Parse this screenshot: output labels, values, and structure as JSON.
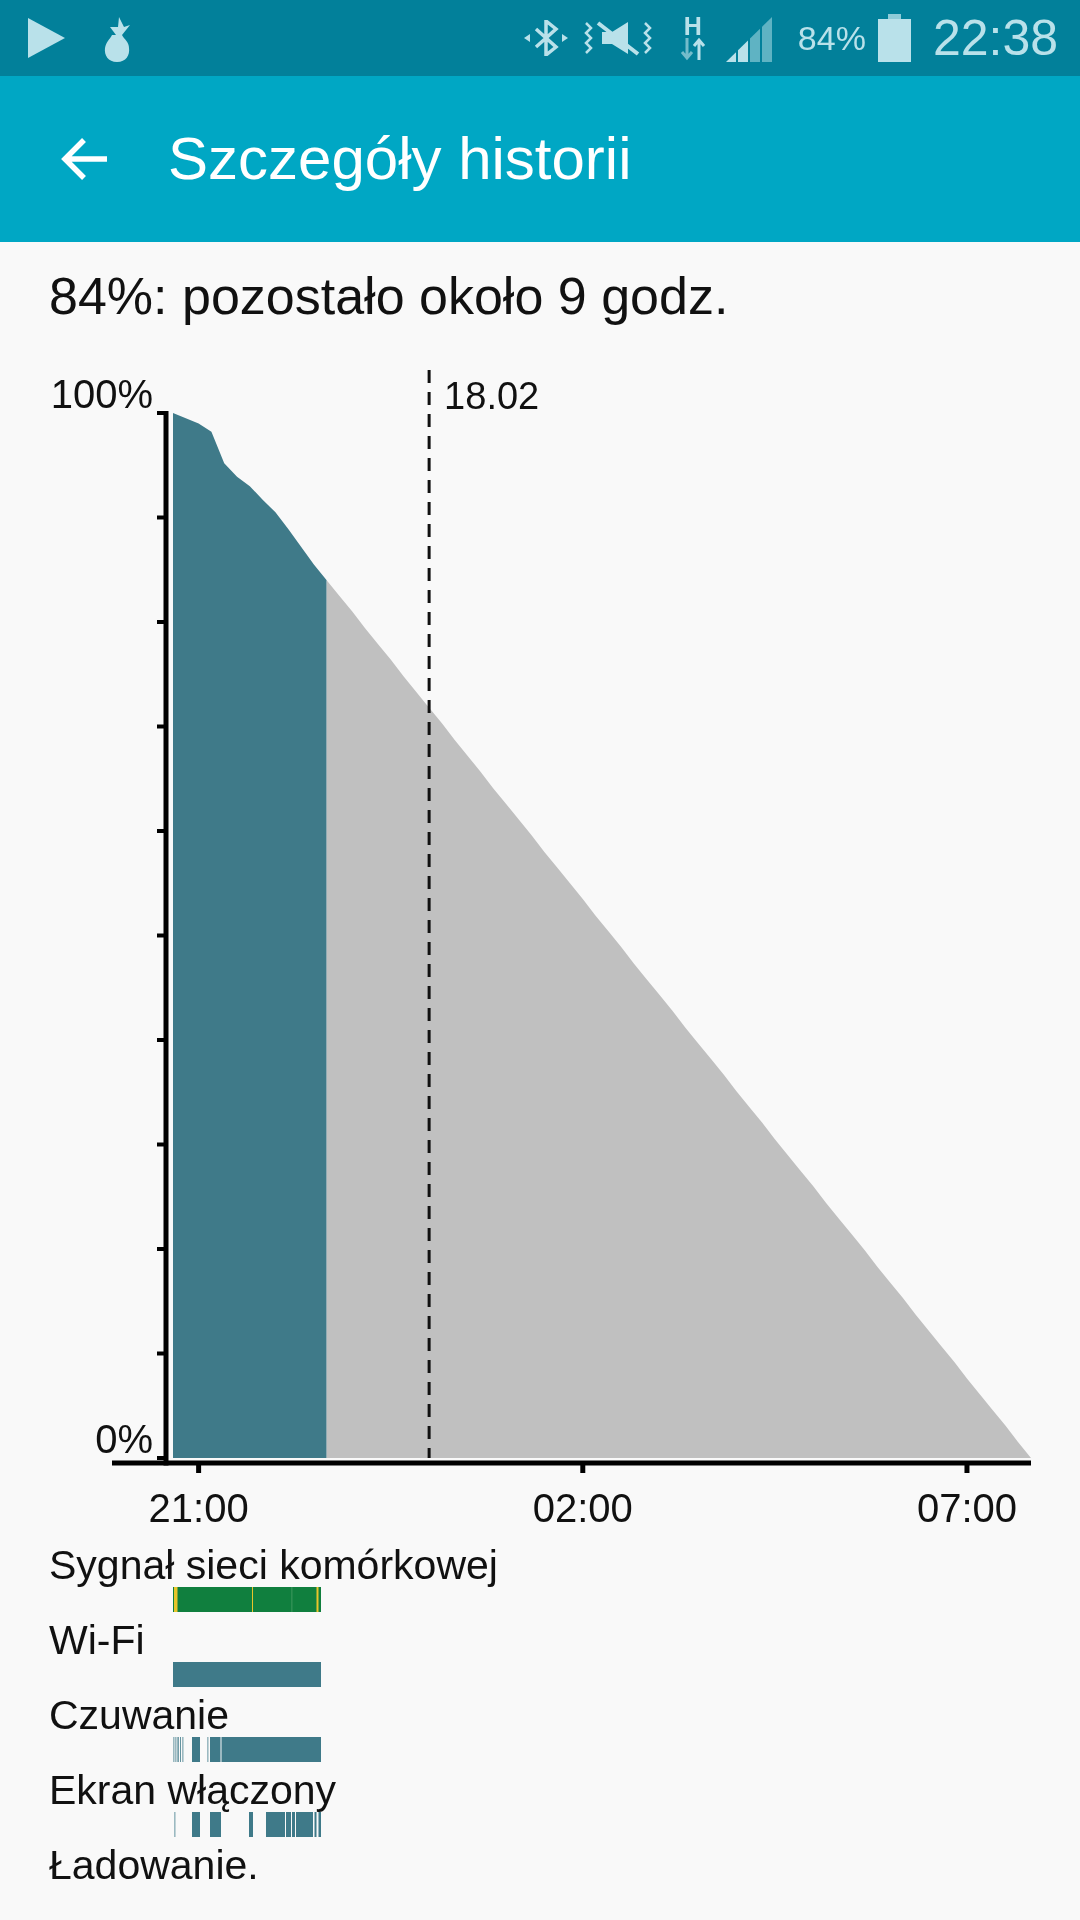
{
  "status_bar": {
    "network_type": "H",
    "battery": "84%",
    "time": "22:38"
  },
  "app_bar": {
    "title": "Szczegóły historii"
  },
  "summary": "84%: pozostało około 9 godz.",
  "history_chart": {
    "chart_data": {
      "type": "area",
      "categories": [
        null,
        null,
        "21:00",
        null,
        null,
        null,
        null,
        null,
        null,
        null,
        null,
        null,
        null,
        null,
        null,
        null,
        null,
        null,
        null,
        null,
        null,
        null,
        null,
        null,
        null,
        null,
        null,
        null,
        null,
        null,
        null,
        null,
        "02:00",
        null,
        null,
        null,
        null,
        null,
        null,
        null,
        null,
        null,
        null,
        null,
        null,
        null,
        null,
        null,
        null,
        null,
        null,
        null,
        null,
        null,
        null,
        null,
        null,
        null,
        null,
        null,
        null,
        null,
        "07:00",
        null,
        null,
        null,
        null,
        null
      ],
      "series": [
        {
          "color": "#3f7a89",
          "values": [
            100,
            99.5,
            99,
            98.2,
            95.2,
            93.9,
            93,
            91.7,
            90.5,
            88.9,
            87.2,
            85.5,
            84,
            null,
            null,
            null,
            null,
            null,
            null,
            null,
            null,
            null,
            null,
            null,
            null,
            null,
            null,
            null,
            null,
            null,
            null,
            null,
            null,
            null,
            null,
            null,
            null,
            null,
            null,
            null,
            null,
            null,
            null,
            null,
            null,
            null,
            null,
            null,
            null,
            null,
            null,
            null,
            null,
            null,
            null,
            null,
            null,
            null,
            null,
            null,
            null,
            null,
            null,
            null,
            null,
            null,
            null,
            null
          ]
        },
        {
          "color": "#c0c0c0",
          "values": [
            null,
            null,
            null,
            null,
            null,
            null,
            null,
            null,
            null,
            null,
            null,
            null,
            84,
            82.5,
            81,
            79.4,
            77.9,
            76.4,
            74.8,
            73.3,
            71.8,
            70.3,
            68.7,
            67.2,
            65.7,
            64.1,
            62.6,
            61.1,
            59.6,
            58,
            56.5,
            55,
            53.5,
            51.9,
            50.4,
            48.9,
            47.3,
            45.8,
            44.3,
            42.8,
            41.2,
            39.7,
            38.2,
            36.7,
            35.1,
            33.6,
            32.1,
            30.5,
            29,
            27.5,
            26,
            24.4,
            22.9,
            21.4,
            19.9,
            18.3,
            16.8,
            15.3,
            13.7,
            12.2,
            10.7,
            9.2,
            7.6,
            6.1,
            4.6,
            3.1,
            1.5,
            0
          ]
        }
      ],
      "ylim": [
        0,
        100
      ],
      "yticks": [
        {
          "value": 0,
          "label": "0%"
        },
        {
          "value": 100,
          "label": "100%"
        }
      ],
      "annotations": [
        "18.02"
      ]
    }
  },
  "timelines": [
    {
      "label": "Sygnał sieci komórkowej",
      "kind": "signal"
    },
    {
      "label": "Wi-Fi",
      "kind": "solid"
    },
    {
      "label": "Czuwanie",
      "kind": "awake"
    },
    {
      "label": "Ekran włączony",
      "kind": "screen"
    },
    {
      "label": "Ładowanie.",
      "kind": "none"
    }
  ]
}
